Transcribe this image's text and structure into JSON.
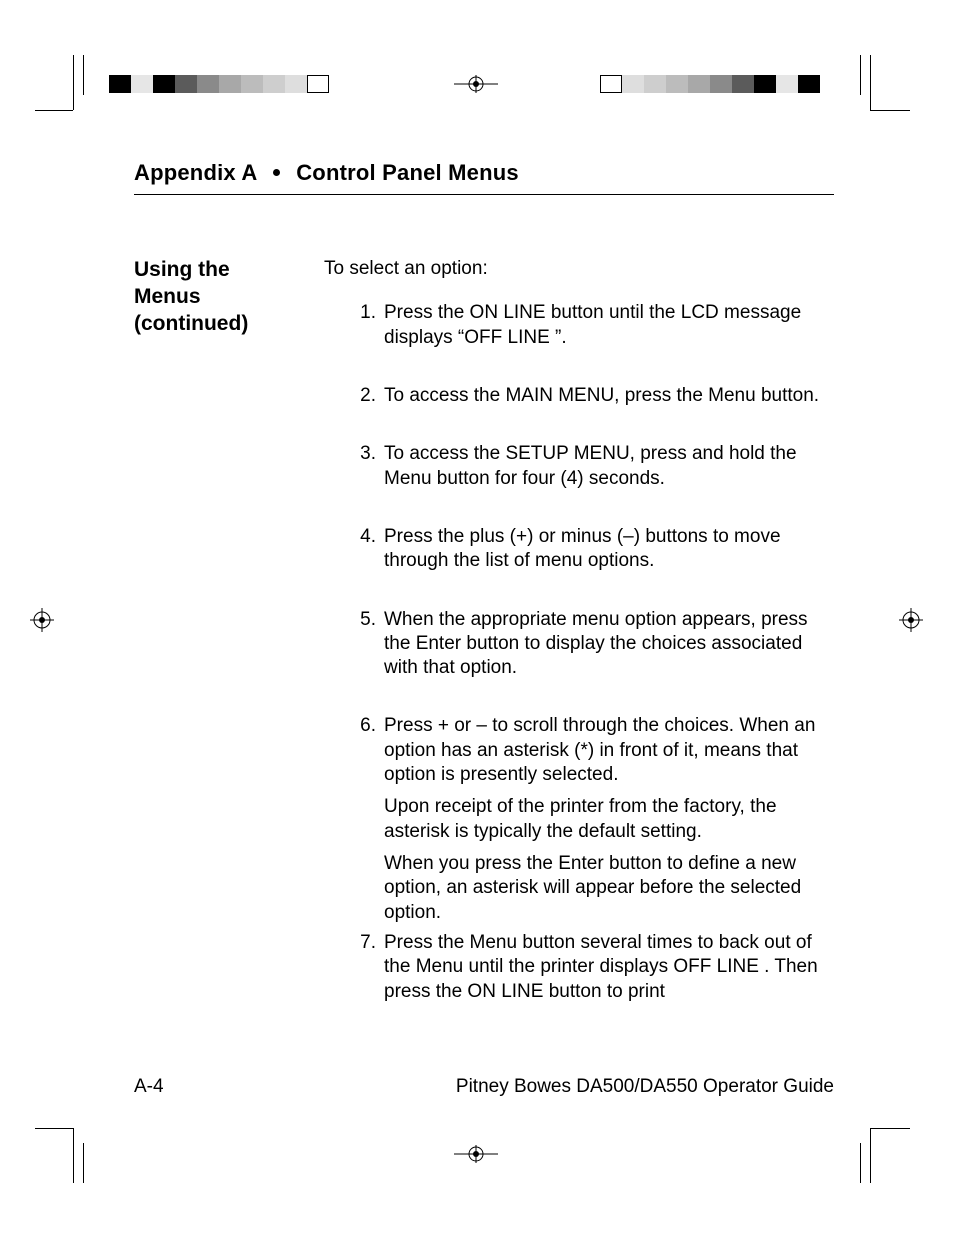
{
  "header": {
    "left": "Appendix A",
    "right": "Control Panel Menus"
  },
  "side_heading": {
    "line1": "Using the",
    "line2": "Menus",
    "line3": "(continued)"
  },
  "intro": "To select an option:",
  "steps": [
    {
      "n": "1.",
      "text": "Press the ON LINE button until the LCD message displays “OFF LINE ”."
    },
    {
      "n": "2.",
      "text": "To access the MAIN MENU, press the Menu button."
    },
    {
      "n": "3.",
      "text": "To access the SETUP MENU, press and hold the Menu button for four (4) seconds."
    },
    {
      "n": "4.",
      "text": "Press the plus (+) or minus (–) buttons to move through the list of menu options."
    },
    {
      "n": "5.",
      "text": "When the appropriate menu option appears, press the Enter button to display the choices associated with that option."
    },
    {
      "n": "6.",
      "text": "Press + or – to scroll through the choices. When an option has an asterisk (*) in front of it, means that option is presently selected.",
      "extra": [
        "Upon receipt of the printer from the factory, the asterisk is typically the default setting.",
        "When you press the Enter button to define a new option, an asterisk will appear before the selected option."
      ]
    },
    {
      "n": "7.",
      "text": "Press the Menu button several times to back out of the Menu until the printer displays OFF LINE . Then press the ON LINE button to print"
    }
  ],
  "footer": {
    "left": "A-4",
    "right": "Pitney Bowes DA500/DA550 Operator Guide"
  },
  "greys_left": [
    "#000000",
    "#e6e6e6",
    "#000000",
    "#5b5b5b",
    "#8a8a8a",
    "#a8a8a8",
    "#bcbcbc",
    "#cecece",
    "#dedede",
    "#ffffff"
  ],
  "greys_right": [
    "#000000",
    "#e6e6e6",
    "#000000",
    "#5b5b5b",
    "#8a8a8a",
    "#a8a8a8",
    "#bcbcbc",
    "#cecece",
    "#dedede",
    "#ffffff"
  ]
}
